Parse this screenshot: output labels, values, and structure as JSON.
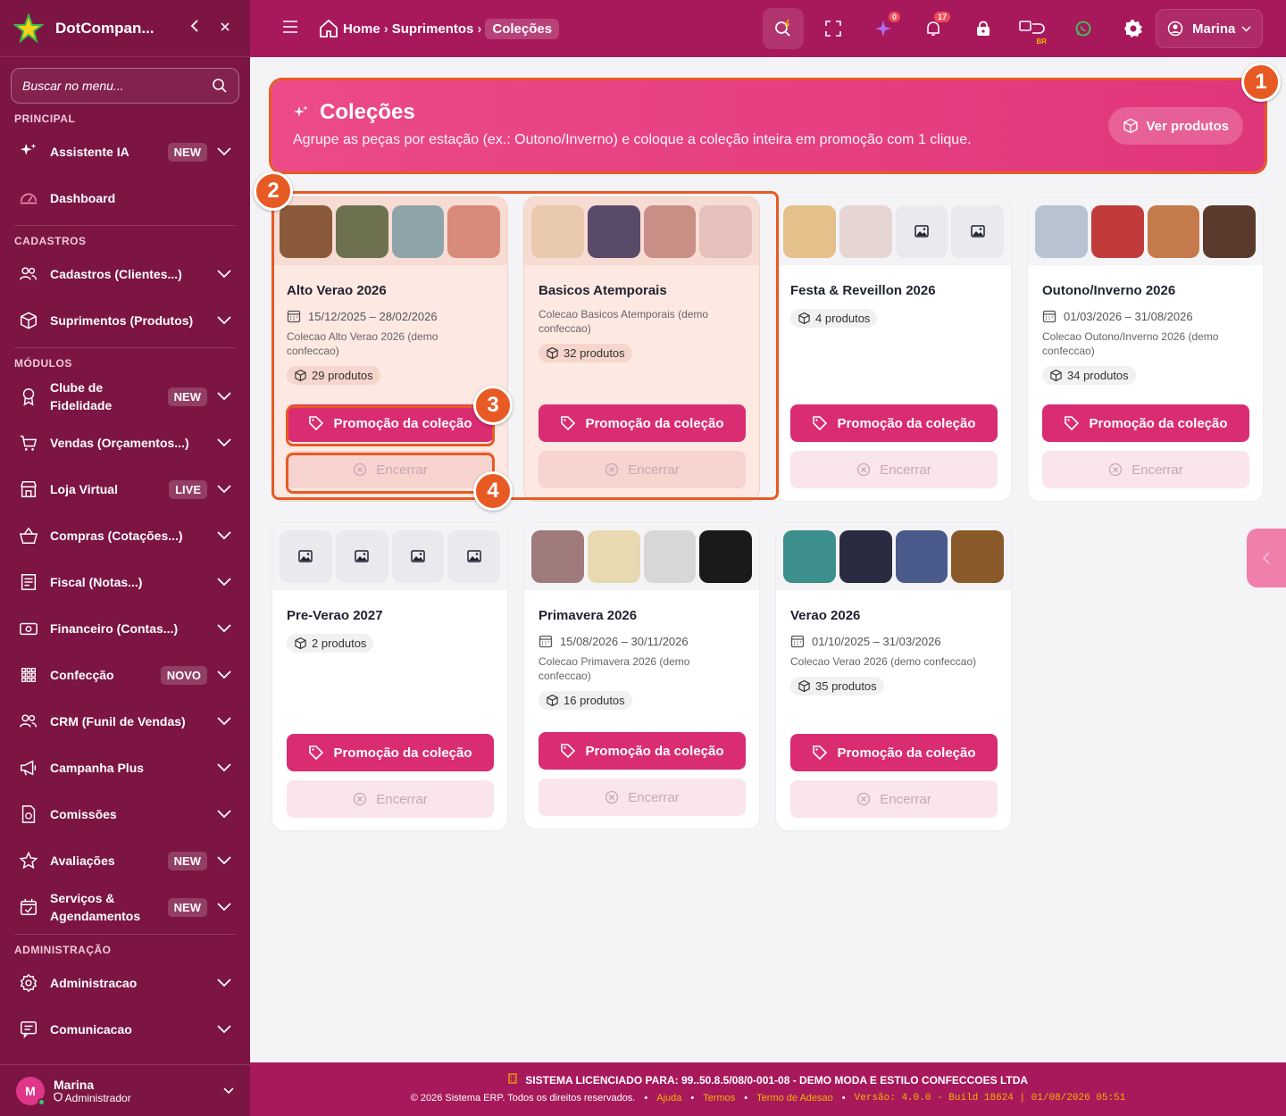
{
  "app": {
    "name": "DotCompan...",
    "collapse_icon": "chevron-left",
    "close_icon": "close"
  },
  "sidebar": {
    "search_placeholder": "Buscar no menu...",
    "sections": [
      {
        "title": "PRINCIPAL",
        "items": [
          {
            "label": "Assistente IA",
            "icon": "sparkles-icon",
            "badge": "NEW",
            "chevron": true
          },
          {
            "label": "Dashboard",
            "icon": "gauge-icon",
            "badge": "",
            "chevron": false
          }
        ]
      },
      {
        "title": "CADASTROS",
        "items": [
          {
            "label": "Cadastros (Clientes...)",
            "icon": "users-icon",
            "badge": "",
            "chevron": true
          },
          {
            "label": "Suprimentos (Produtos)",
            "icon": "box-icon",
            "badge": "",
            "chevron": true
          }
        ]
      },
      {
        "title": "MÓDULOS",
        "items": [
          {
            "label": "Clube de Fidelidade",
            "icon": "award-icon",
            "badge": "NEW",
            "chevron": true
          },
          {
            "label": "Vendas (Orçamentos...)",
            "icon": "cart-icon",
            "badge": "",
            "chevron": true
          },
          {
            "label": "Loja Virtual",
            "icon": "store-icon",
            "badge": "LIVE",
            "chevron": true
          },
          {
            "label": "Compras (Cotações...)",
            "icon": "basket-icon",
            "badge": "",
            "chevron": true
          },
          {
            "label": "Fiscal (Notas...)",
            "icon": "receipt-icon",
            "badge": "",
            "chevron": true
          },
          {
            "label": "Financeiro (Contas...)",
            "icon": "cash-icon",
            "badge": "",
            "chevron": true
          },
          {
            "label": "Confecção",
            "icon": "grid-icon",
            "badge": "NOVO",
            "chevron": true
          },
          {
            "label": "CRM (Funil de Vendas)",
            "icon": "users-icon",
            "badge": "",
            "chevron": true
          },
          {
            "label": "Campanha Plus",
            "icon": "megaphone-icon",
            "badge": "",
            "chevron": true
          },
          {
            "label": "Comissões",
            "icon": "document-money-icon",
            "badge": "",
            "chevron": true
          },
          {
            "label": "Avaliações",
            "icon": "star-icon",
            "badge": "NEW",
            "chevron": true
          },
          {
            "label": "Serviços & Agendamentos",
            "icon": "calendar-check-icon",
            "badge": "NEW",
            "chevron": true
          }
        ]
      },
      {
        "title": "ADMINISTRAÇÃO",
        "items": [
          {
            "label": "Administracao",
            "icon": "gear-icon",
            "badge": "",
            "chevron": true
          },
          {
            "label": "Comunicacao",
            "icon": "chat-icon",
            "badge": "",
            "chevron": true
          }
        ]
      }
    ],
    "user": {
      "initial": "M",
      "name": "Marina",
      "role": "Administrador"
    }
  },
  "header": {
    "breadcrumbs": [
      {
        "label": "Home"
      },
      {
        "label": "Suprimentos"
      },
      {
        "label": "Coleções"
      }
    ],
    "icons": [
      {
        "name": "search-flash-icon",
        "count": ""
      },
      {
        "name": "fullscreen-icon",
        "count": ""
      },
      {
        "name": "ai-sparkle-icon",
        "count": "0"
      },
      {
        "name": "bell-icon",
        "count": "17"
      },
      {
        "name": "lock-bag-icon",
        "count": ""
      },
      {
        "name": "language-icon",
        "count": "BR"
      },
      {
        "name": "whatsapp-icon",
        "count": ""
      },
      {
        "name": "gear-icon",
        "count": ""
      }
    ],
    "user_label": "Marina"
  },
  "hero": {
    "title": "Coleções",
    "subtitle": "Agrupe as peças por estação (ex.: Outono/Inverno) e coloque a coleção inteira em promoção com 1 clique.",
    "button": "Ver produtos"
  },
  "buttons": {
    "promo": "Promoção da coleção",
    "end": "Encerrar"
  },
  "collections": [
    {
      "title": "Alto Verao 2026",
      "date": "15/12/2025 – 28/02/2026",
      "desc": "Colecao Alto Verao 2026 (demo confeccao)",
      "count": "29 produtos",
      "thumbs": [
        "#8a5a3a",
        "#6d7150",
        "#8fa4a8",
        "#d98a7a"
      ]
    },
    {
      "title": "Basicos Atemporais",
      "date": "",
      "desc": "Colecao Basicos Atemporais (demo confeccao)",
      "count": "32 produtos",
      "thumbs": [
        "#e9c9ae",
        "#5a4a6a",
        "#c98f86",
        "#e6c0bc"
      ]
    },
    {
      "title": "Festa & Reveillon 2026",
      "date": "",
      "desc": "",
      "count": "4 produtos",
      "thumbs": [
        "#e5c08a",
        "#e6d6d3",
        "",
        ""
      ]
    },
    {
      "title": "Outono/Inverno 2026",
      "date": "01/03/2026 – 31/08/2026",
      "desc": "Colecao Outono/Inverno 2026 (demo confeccao)",
      "count": "34 produtos",
      "thumbs": [
        "#b8c2d0",
        "#c23b3b",
        "#c57a4b",
        "#5b3a2e"
      ]
    },
    {
      "title": "Pre-Verao 2027",
      "date": "",
      "desc": "",
      "count": "2 produtos",
      "thumbs": [
        "",
        "",
        "",
        ""
      ]
    },
    {
      "title": "Primavera 2026",
      "date": "15/08/2026 – 30/11/2026",
      "desc": "Colecao Primavera 2026 (demo confeccao)",
      "count": "16 produtos",
      "thumbs": [
        "#9e7b7a",
        "#e8d9b0",
        "#d8d6d6",
        "#1a1a1a"
      ]
    },
    {
      "title": "Verao 2026",
      "date": "01/10/2025 – 31/03/2026",
      "desc": "Colecao Verao 2026 (demo confeccao)",
      "count": "35 produtos",
      "thumbs": [
        "#3c8f8a",
        "#2a2a40",
        "#4a5a8a",
        "#8a5a2a"
      ]
    }
  ],
  "callouts": [
    "1",
    "2",
    "3",
    "4"
  ],
  "footer": {
    "license": "SISTEMA LICENCIADO PARA: 99..50.8.5/08/0-001-08 - DEMO MODA E ESTILO CONFECCOES LTDA",
    "copyright": "© 2026 Sistema ERP. Todos os direitos reservados.",
    "links": [
      "Ajuda",
      "Termos",
      "Termo de Adesao"
    ],
    "version": "Versão: 4.0.0 - Build 18624 | 01/08/2026 05:51"
  },
  "colors": {
    "sidebar": "#7c1444",
    "header": "#a8195b",
    "primary": "#d92c72",
    "callout": "#e85a24"
  }
}
